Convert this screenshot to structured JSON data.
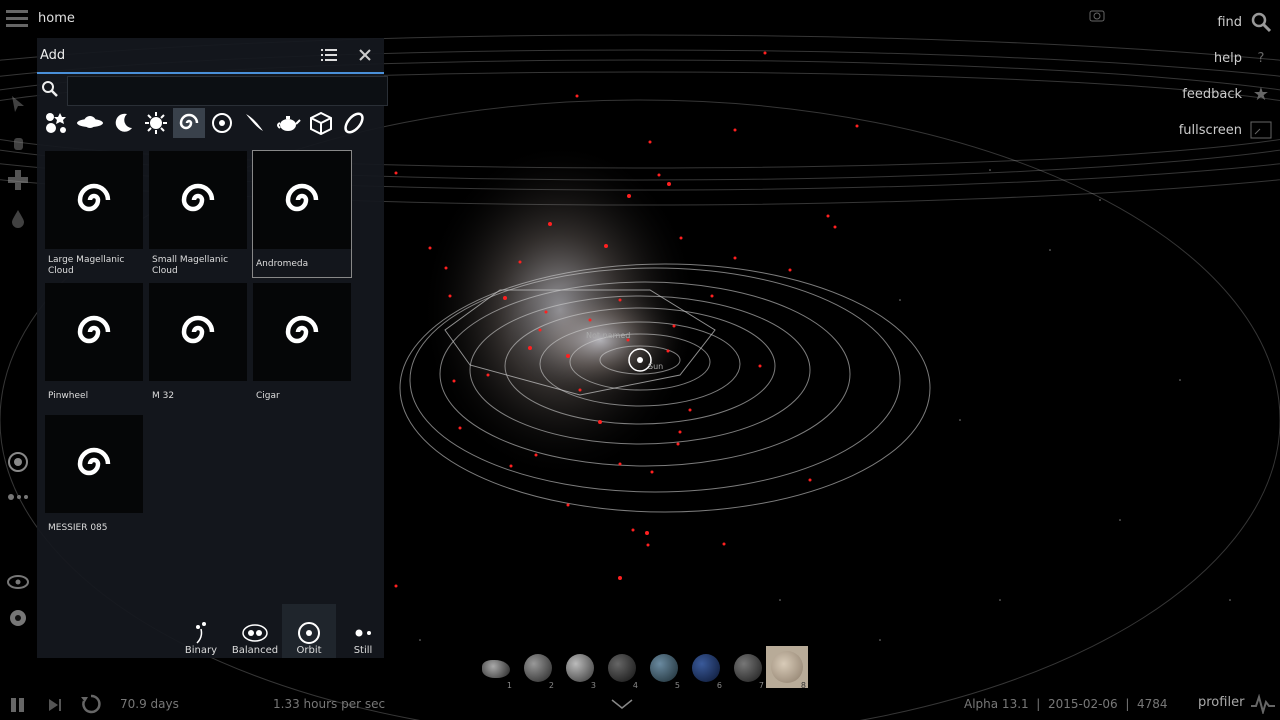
{
  "top": {
    "home_label": "home"
  },
  "right_menu": [
    {
      "label": "find",
      "icon": "search-icon"
    },
    {
      "label": "help",
      "icon": "question-icon"
    },
    {
      "label": "feedback",
      "icon": "star-icon"
    },
    {
      "label": "fullscreen",
      "icon": "fullscreen-icon"
    }
  ],
  "panel": {
    "title": "Add",
    "search_placeholder": "",
    "categories": [
      "multi-star-icon",
      "planet-icon",
      "moon-icon",
      "sun-icon",
      "galaxy-icon",
      "spiral-icon",
      "comet-icon",
      "teapot-icon",
      "cube-icon",
      "ring-icon"
    ],
    "items": [
      {
        "label": "Large Magellanic Cloud"
      },
      {
        "label": "Small Magellanic Cloud"
      },
      {
        "label": "Andromeda"
      },
      {
        "label": "Pinwheel"
      },
      {
        "label": "M 32"
      },
      {
        "label": "Cigar"
      },
      {
        "label": "MESSIER 085"
      }
    ],
    "modes": [
      "Binary",
      "Balanced",
      "Orbit",
      "Still"
    ]
  },
  "scene": {
    "label_not_named": "Not named",
    "label_sun": "Sun"
  },
  "bottom": {
    "time_elapsed": "70.9 days",
    "time_rate": "1.33 hours per sec",
    "status": "Alpha 13.1  |  2015-02-06  |  4784",
    "profiler": "profiler",
    "slots": [
      "1",
      "2",
      "3",
      "4",
      "5",
      "6",
      "7",
      "8"
    ]
  },
  "colors": {
    "accent": "#4a90d9",
    "star_red": "#ff2020"
  }
}
